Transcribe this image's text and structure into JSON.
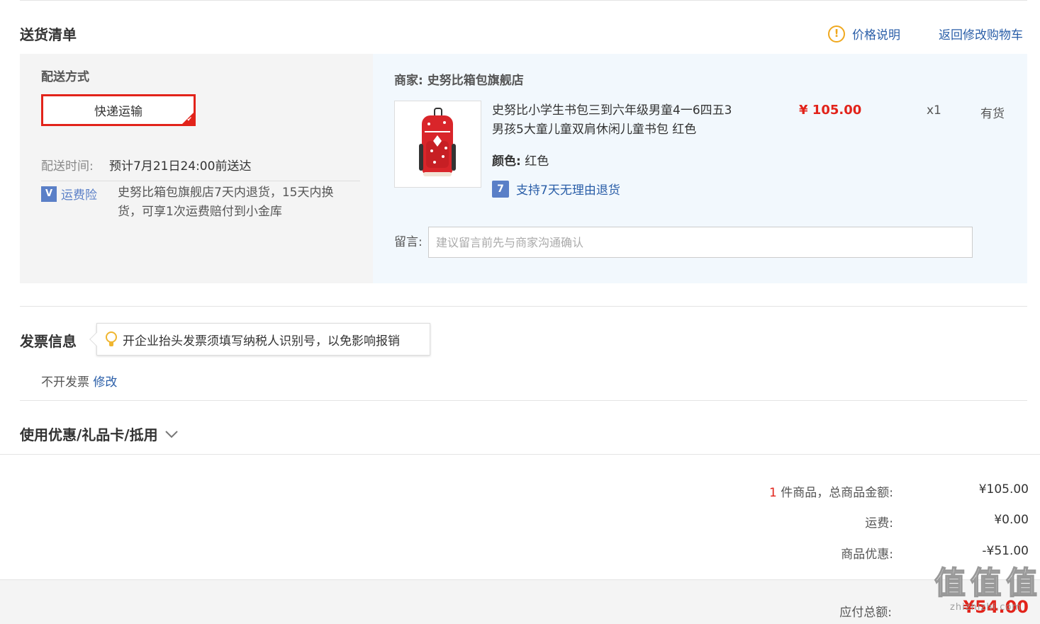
{
  "delivery": {
    "title": "送货清单",
    "price_note": "价格说明",
    "back_to_cart": "返回修改购物车",
    "method_label": "配送方式",
    "method_value": "快递运输",
    "time_label": "配送时间:",
    "time_value": "预计7月21日24:00前送达",
    "insurance_badge": "运费险",
    "insurance_line1": "史努比箱包旗舰店7天内退货，15天内换",
    "insurance_line2": "货，可享1次运费赔付到小金库"
  },
  "goods": {
    "merchant_label": "商家:",
    "merchant_name": "史努比箱包旗舰店",
    "product_title_line1": "史努比小学生书包三到六年级男童4一6四五3",
    "product_title_line2": "男孩5大童儿童双肩休闲儿童书包 红色",
    "price": "¥ 105.00",
    "quantity": "x1",
    "stock": "有货",
    "color_label": "颜色:",
    "color_value": "红色",
    "return_badge": "7",
    "return_policy": "支持7天无理由退货",
    "remark_label": "留言:",
    "remark_placeholder": "建议留言前先与商家沟通确认"
  },
  "invoice": {
    "title": "发票信息",
    "tip": "开企业抬头发票须填写纳税人识别号，以免影响报销",
    "status": "不开发票",
    "edit": "修改"
  },
  "coupon": {
    "title": "使用优惠/礼品卡/抵用"
  },
  "summary": {
    "count": "1",
    "count_label": "件商品，总商品金额:",
    "goods_total": "¥105.00",
    "shipping_label": "运费:",
    "shipping_value": "¥0.00",
    "discount_label": "商品优惠:",
    "discount_value": "-¥51.00",
    "total_label": "应付总额:",
    "total_value": "¥54.00"
  },
  "watermark": {
    "text": "值",
    "site": "zhizhizhi.com"
  },
  "colors": {
    "accent_red": "#e2231a",
    "link_blue": "#2a5ea8",
    "badge_blue": "#5a7fc7",
    "warn_orange": "#f0a81e"
  }
}
